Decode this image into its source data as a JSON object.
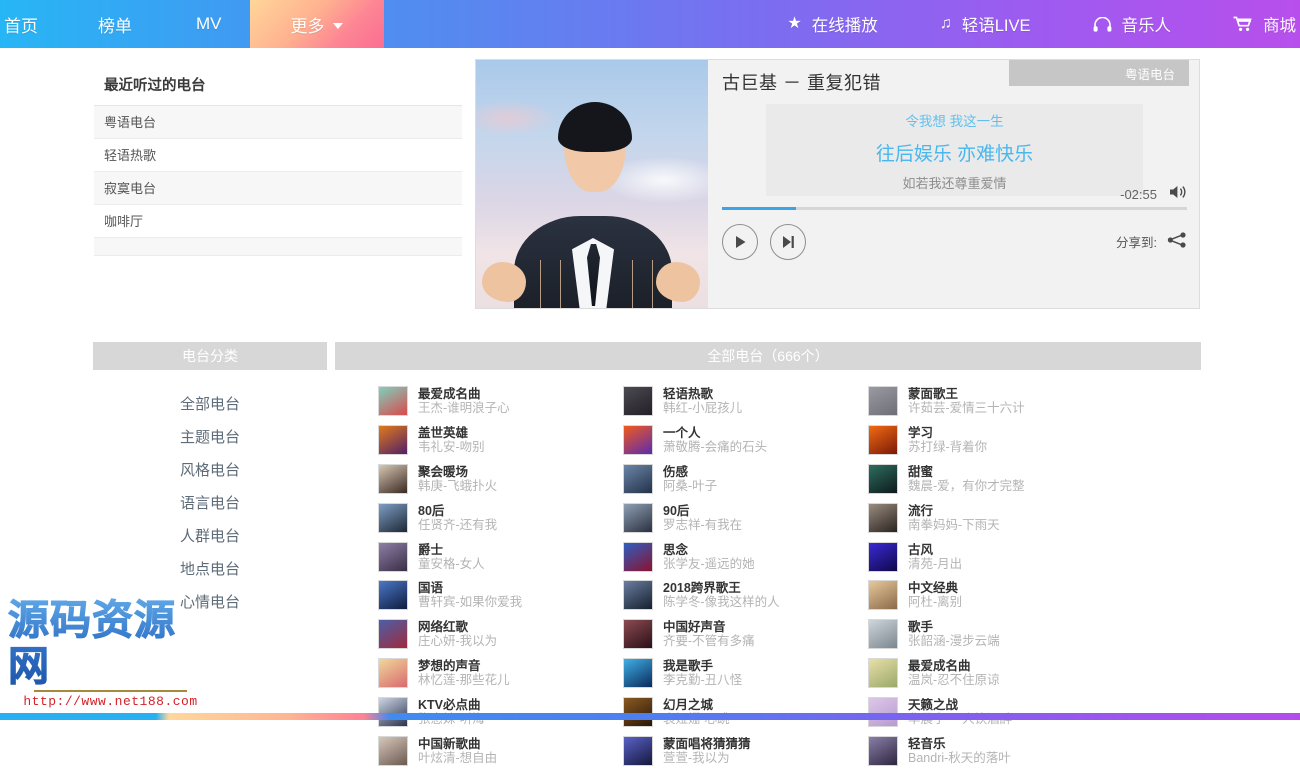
{
  "nav": {
    "left_items": [
      {
        "label": "首页",
        "name": "nav-home"
      },
      {
        "label": "榜单",
        "name": "nav-rank"
      },
      {
        "label": "MV",
        "name": "nav-mv"
      },
      {
        "label": "更多",
        "name": "nav-more"
      }
    ],
    "right_items": [
      {
        "label": "在线播放",
        "icon": "star-icon"
      },
      {
        "label": "轻语LIVE",
        "icon": "music-note-icon"
      },
      {
        "label": "音乐人",
        "icon": "headphones-icon"
      },
      {
        "label": "商城",
        "icon": "cart-icon"
      }
    ],
    "accent_gradient_start": "#27b6f5",
    "accent_gradient_end": "#b84fec",
    "more_tab_gradient_start": "#ffd69a",
    "more_tab_gradient_end": "#fb6d92"
  },
  "recent": {
    "title": "最近听过的电台",
    "items": [
      "粤语电台",
      "轻语热歌",
      "寂寞电台",
      "咖啡厅"
    ]
  },
  "player": {
    "song_title": "古巨基 － 重复犯错",
    "station_tab": "粤语电台",
    "lyric_prev": "令我想 我这一生",
    "lyric_current": "往后娱乐 亦难快乐",
    "lyric_next": "如若我还尊重爱情",
    "time_remaining": "-02:55",
    "share_label": "分享到:",
    "progress_percent": 16,
    "progress_color": "#3ba3e8",
    "lyric_color": "#49b7ee"
  },
  "sections": {
    "category_header": "电台分类",
    "all_header": "全部电台（666个）"
  },
  "categories": [
    "全部电台",
    "主题电台",
    "风格电台",
    "语言电台",
    "人群电台",
    "地点电台",
    "心情电台"
  ],
  "stations": [
    {
      "name": "最爱成名曲",
      "sub": "王杰-谁明浪子心",
      "c1": "#7fd0bf",
      "c2": "#d94a4a"
    },
    {
      "name": "轻语热歌",
      "sub": "韩红-小屁孩儿",
      "c1": "#4c4a52",
      "c2": "#221f26"
    },
    {
      "name": "蒙面歌王",
      "sub": "许茹芸-爱情三十六计",
      "c1": "#9a9aa2",
      "c2": "#6e6e78"
    },
    {
      "name": "盖世英雄",
      "sub": "韦礼安-吻别",
      "c1": "#e07a1a",
      "c2": "#51206a"
    },
    {
      "name": "一个人",
      "sub": "萧敬腾-会痛的石头",
      "c1": "#f05a1e",
      "c2": "#5b2bb0"
    },
    {
      "name": "学习",
      "sub": "苏打绿-背着你",
      "c1": "#f26a12",
      "c2": "#7a1a08"
    },
    {
      "name": "聚会暖场",
      "sub": "韩庚-飞蛾扑火",
      "c1": "#d8c7b4",
      "c2": "#3a2a22"
    },
    {
      "name": "伤感",
      "sub": "阿桑-叶子",
      "c1": "#6b86a8",
      "c2": "#23324a"
    },
    {
      "name": "甜蜜",
      "sub": "魏晨-爱，有你才完整",
      "c1": "#2d6e5e",
      "c2": "#0e1a1e"
    },
    {
      "name": "80后",
      "sub": "任贤齐-还有我",
      "c1": "#7e9ec4",
      "c2": "#1d2836"
    },
    {
      "name": "90后",
      "sub": "罗志祥-有我在",
      "c1": "#8f9fb4",
      "c2": "#2a3140"
    },
    {
      "name": "流行",
      "sub": "南拳妈妈-下雨天",
      "c1": "#9a8c80",
      "c2": "#2b231e"
    },
    {
      "name": "爵士",
      "sub": "童安格-女人",
      "c1": "#8e7fa6",
      "c2": "#3a2e46"
    },
    {
      "name": "思念",
      "sub": "张学友-遥远的她",
      "c1": "#2f5ec0",
      "c2": "#8a1230"
    },
    {
      "name": "古风",
      "sub": "清苑-月出",
      "c1": "#3a2ad6",
      "c2": "#10084a"
    },
    {
      "name": "国语",
      "sub": "曹轩宾-如果你爱我",
      "c1": "#4a78c8",
      "c2": "#0f1c3e"
    },
    {
      "name": "2018跨界歌王",
      "sub": "陈学冬-像我这样的人",
      "c1": "#6a7ea0",
      "c2": "#16202e"
    },
    {
      "name": "中文经典",
      "sub": "阿杜-离别",
      "c1": "#e8c89a",
      "c2": "#8a6a4a"
    },
    {
      "name": "网络红歌",
      "sub": "庄心妍-我以为",
      "c1": "#4b5fa8",
      "c2": "#a02a3c"
    },
    {
      "name": "中国好声音",
      "sub": "齐要-不管有多痛",
      "c1": "#8c4a52",
      "c2": "#2a1016"
    },
    {
      "name": "歌手",
      "sub": "张韶涵-漫步云端",
      "c1": "#cfd6dc",
      "c2": "#7b868e"
    },
    {
      "name": "梦想的声音",
      "sub": "林忆莲-那些花儿",
      "c1": "#f0d89a",
      "c2": "#d96a70"
    },
    {
      "name": "我是歌手",
      "sub": "李克勤-丑八怪",
      "c1": "#3fb0e8",
      "c2": "#0a2a5a"
    },
    {
      "name": "最爱成名曲",
      "sub": "温岚-忍不住原谅",
      "c1": "#e8e0a8",
      "c2": "#9aa86a"
    },
    {
      "name": "KTV必点曲",
      "sub": "张惠妹-听海",
      "c1": "#cdd6e4",
      "c2": "#2a3250"
    },
    {
      "name": "幻月之城",
      "sub": "袁娅姗-心跳",
      "c1": "#8a5a22",
      "c2": "#2a1608"
    },
    {
      "name": "天籁之战",
      "sub": "华晨宇-一人饮酒醉",
      "c1": "#dcc8e8",
      "c2": "#b89ad0"
    },
    {
      "name": "中国新歌曲",
      "sub": "叶炫清-想自由",
      "c1": "#d8c8bc",
      "c2": "#6a5a50"
    },
    {
      "name": "蒙面唱将猜猜猜",
      "sub": "萱萱-我以为",
      "c1": "#5a62c8",
      "c2": "#14183c"
    },
    {
      "name": "轻音乐",
      "sub": "Bandri-秋天的落叶",
      "c1": "#8a7fa8",
      "c2": "#2e2640"
    }
  ],
  "watermark": {
    "text": "源码资源网",
    "url": "http://www.net188.com"
  }
}
